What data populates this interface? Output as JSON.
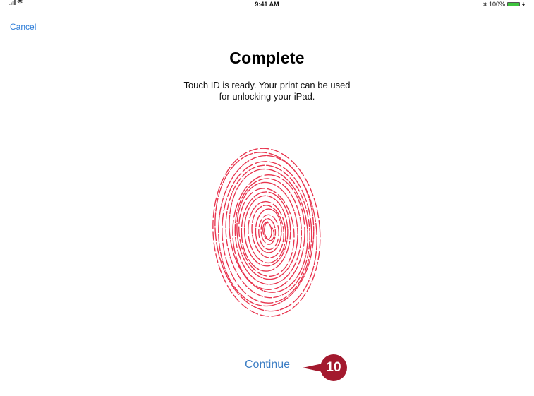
{
  "status_bar": {
    "time": "9:41 AM",
    "battery_text": "100%",
    "battery_level": 1.0,
    "icons": [
      "signal-icon",
      "wifi-icon",
      "bluetooth-icon",
      "battery-icon",
      "charging-icon"
    ]
  },
  "nav": {
    "cancel_label": "Cancel"
  },
  "main": {
    "title": "Complete",
    "subtitle_line1": "Touch ID is ready. Your print can be used",
    "subtitle_line2": "for unlocking your iPad.",
    "fingerprint_icon": "fingerprint-icon",
    "continue_label": "Continue"
  },
  "callout": {
    "number": "10"
  },
  "colors": {
    "accent": "#2f7ed8",
    "fingerprint": "#e8344e",
    "callout": "#a3192e",
    "battery": "#3ec43e"
  }
}
